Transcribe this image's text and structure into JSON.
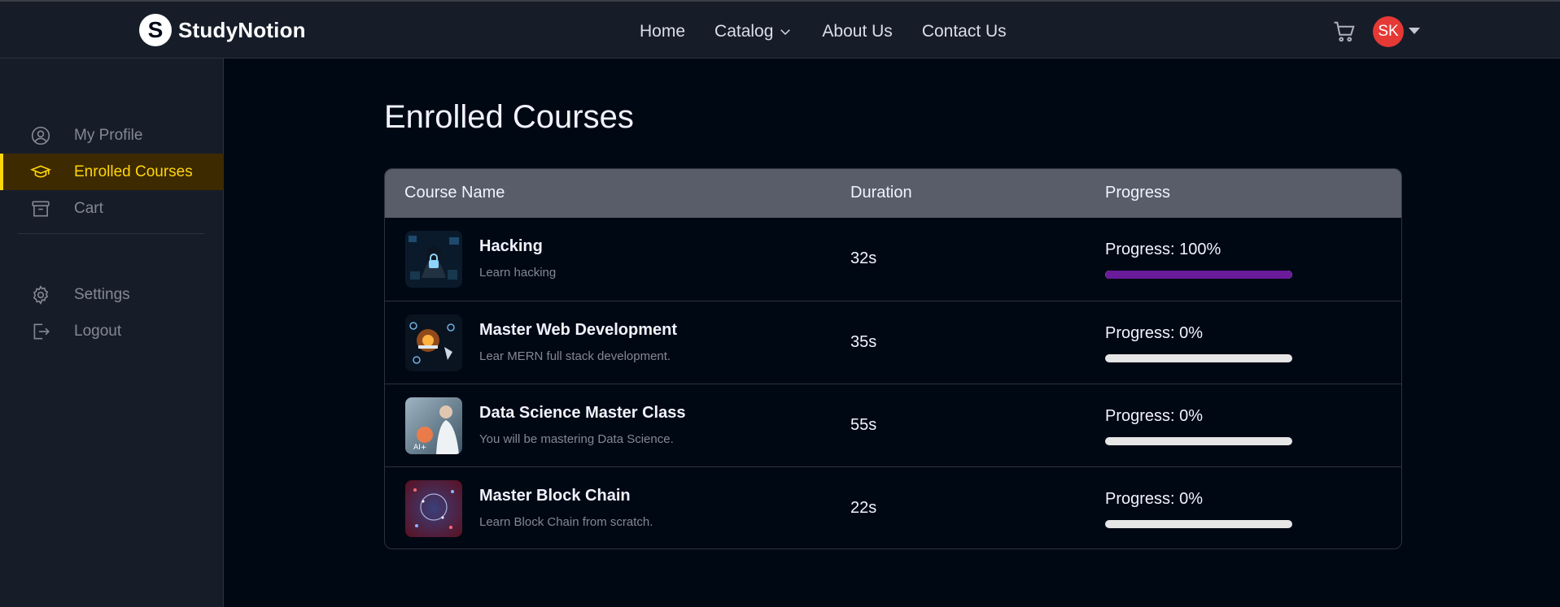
{
  "header": {
    "brand": "StudyNotion",
    "brand_mark": "S",
    "nav": [
      {
        "label": "Home"
      },
      {
        "label": "Catalog",
        "has_dropdown": true
      },
      {
        "label": "About Us"
      },
      {
        "label": "Contact Us"
      }
    ],
    "cart_icon": "cart-icon",
    "avatar_initials": "SK",
    "avatar_color": "#e53935"
  },
  "sidebar": {
    "items": [
      {
        "label": "My Profile",
        "icon": "user-circle-icon",
        "active": false
      },
      {
        "label": "Enrolled Courses",
        "icon": "graduation-cap-icon",
        "active": true
      },
      {
        "label": "Cart",
        "icon": "archive-box-icon",
        "active": false
      }
    ],
    "bottom_items": [
      {
        "label": "Settings",
        "icon": "gear-icon"
      },
      {
        "label": "Logout",
        "icon": "logout-icon"
      }
    ]
  },
  "main": {
    "title": "Enrolled Courses",
    "table": {
      "headers": [
        "Course Name",
        "Duration",
        "Progress"
      ],
      "rows": [
        {
          "name": "Hacking",
          "description": "Learn hacking",
          "duration": "32s",
          "progress_label": "Progress: 100%",
          "progress": 100
        },
        {
          "name": "Master Web Development",
          "description": "Lear MERN full stack development.",
          "duration": "35s",
          "progress_label": "Progress: 0%",
          "progress": 0
        },
        {
          "name": "Data Science Master Class",
          "description": "You will be mastering Data Science.",
          "duration": "55s",
          "progress_label": "Progress: 0%",
          "progress": 0
        },
        {
          "name": "Master Block Chain",
          "description": "Learn Block Chain from scratch.",
          "duration": "22s",
          "progress_label": "Progress: 0%",
          "progress": 0
        }
      ]
    }
  },
  "colors": {
    "accent": "#ffd60a",
    "progress_fill": "#6a1b9a",
    "background": "#000814"
  }
}
